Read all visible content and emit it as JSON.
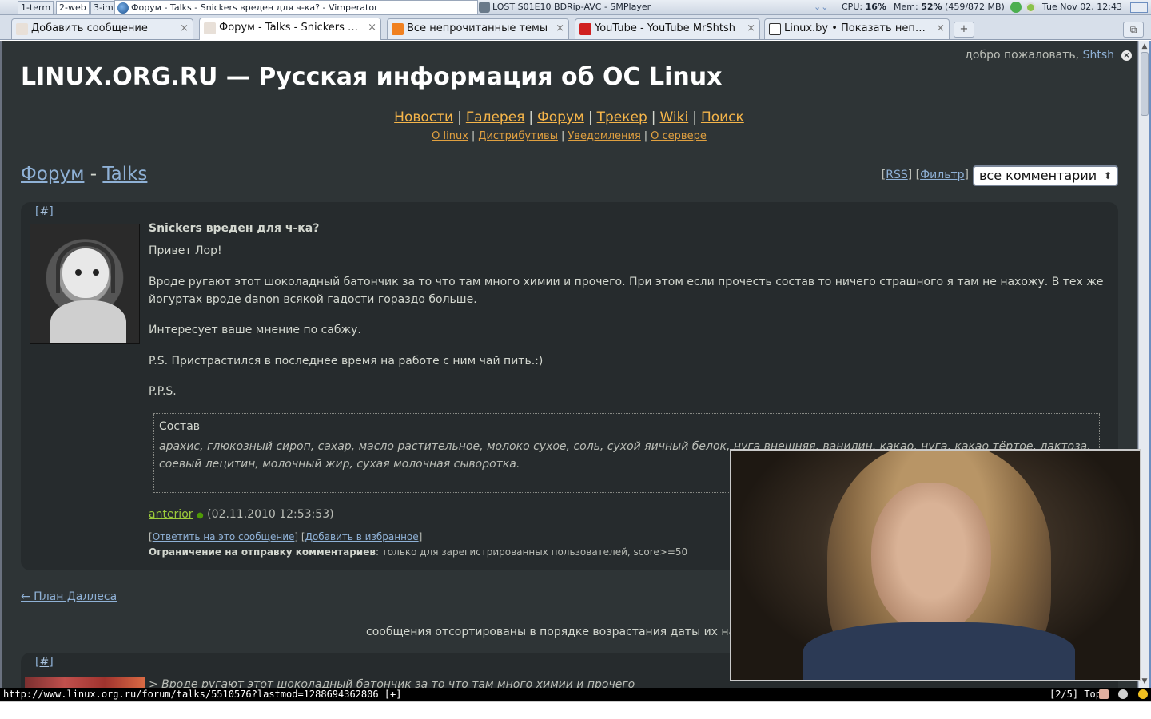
{
  "panel": {
    "workspaces": [
      "1-term",
      "2-web",
      "3-im"
    ],
    "tasks": [
      {
        "title": "Форум - Talks - Snickers вреден для ч-ка? - Vimperator",
        "active": true
      },
      {
        "title": "LOST S01E10 BDRip-AVC - SMPlayer",
        "active": false
      }
    ],
    "cpu_label": "CPU:",
    "cpu_value": "16%",
    "mem_label": "Mem:",
    "mem_value": "52%",
    "mem_detail": "(459/872 MB)",
    "clock": "Tue Nov 02, 12:43"
  },
  "tabs": [
    {
      "title": "Добавить сообщение",
      "favicon_color": "#f0f0f0"
    },
    {
      "title": "Форум - Talks - Snickers в...",
      "favicon_color": "#f0f0f0"
    },
    {
      "title": "Все непрочитанные темы",
      "favicon_color": "#f08020"
    },
    {
      "title": "YouTube - YouTube MrShtsh",
      "favicon_color": "#d02020"
    },
    {
      "title": "Linux.by • Показать непр...",
      "favicon_color": "#ffffff"
    }
  ],
  "newtab_icon": "+",
  "header": {
    "welcome": "добро пожаловать,",
    "username": "Shtsh",
    "logout_icon": "×",
    "site_title": "LINUX.ORG.RU — Русская информация об ОС Linux"
  },
  "nav": {
    "main": [
      "Новости",
      "Галерея",
      "Форум",
      "Трекер",
      "Wiki",
      "Поиск"
    ],
    "sub": [
      "О linux",
      "Дистрибутивы",
      "Уведомления",
      "О сервере"
    ]
  },
  "breadcrumb": {
    "forum": "Форум",
    "sep": "-",
    "section": "Talks"
  },
  "filters": {
    "rss": "RSS",
    "filter": "Фильтр",
    "select_value": "все комментарии"
  },
  "message": {
    "anchor": "#",
    "title": "Snickers вреден для ч-ка?",
    "paragraphs": [
      "Привет Лор!",
      "Вроде ругают этот шоколадный батончик за то что там много химии и прочего. При этом если прочесть состав то ничего страшного я там не нахожу. В тех же йогуртах вроде danon всякой гадости гораздо больше.",
      "Интересует ваше мнение по сабжу.",
      "P.S. Пристрастился в последнее время на работе с ним чай пить.:)",
      "P.P.S."
    ],
    "quote_title": "Состав",
    "quote_body": "арахис, глюкозный сироп, сахар, масло растительное, молоко сухое, соль, сухой яичный белок, нуга внешняя, ванилин, какао, нуга, какао тёртое, лактоза, соевый лецитин, молочный жир, сухая молочная сыворотка.",
    "author": "anterior",
    "online_dot": "●",
    "date": "(02.11.2010 12:53:53)",
    "reply": "Ответить на это сообщение",
    "favorite": "Добавить в избранное",
    "limit_label": "Ограничение на отправку комментариев",
    "limit_value": ": только для зарегистрированных пользователей, score>=50"
  },
  "prev_topic": "← План Даллеса",
  "sort_note": "сообщения отсортированы в порядке возрастания даты их написания",
  "reply_message": {
    "anchor": "#",
    "quote_preview": "> Вроде ругают этот шоколадный батончик за то что там много химии и прочего"
  },
  "statusline": {
    "url": "http://www.linux.org.ru/forum/talks/5510576?lastmod=1288694362806 [+]",
    "position": "[2/5] Top"
  }
}
